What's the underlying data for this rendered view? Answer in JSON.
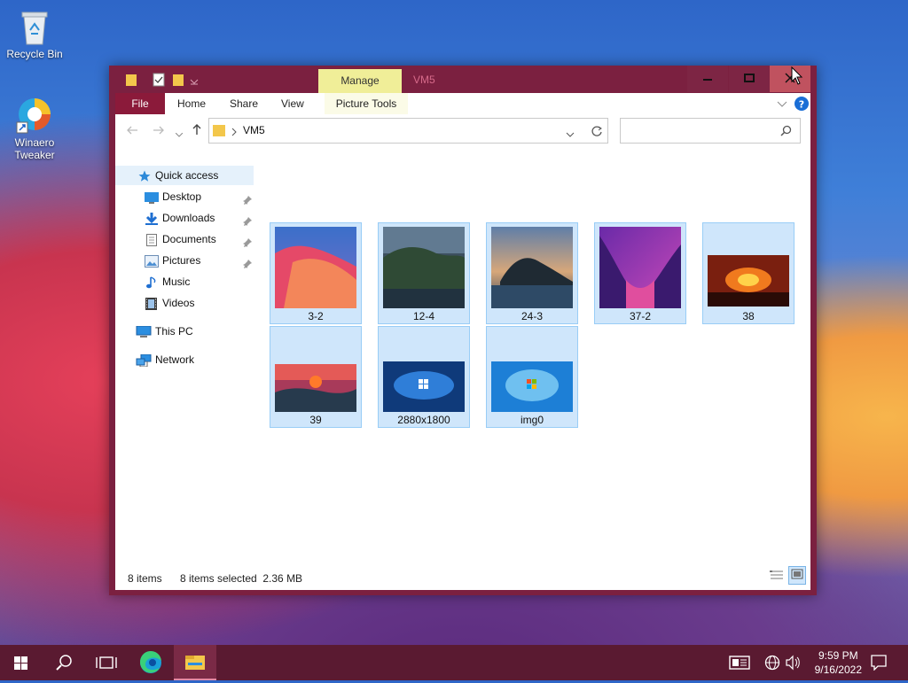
{
  "desktop": {
    "recycle_bin": "Recycle Bin",
    "winaero": "Winaero Tweaker"
  },
  "window": {
    "title": "VM5",
    "manage_tab": "Manage",
    "ribbon_tabs": [
      "File",
      "Home",
      "Share",
      "View",
      "Picture Tools"
    ],
    "address_path": "VM5",
    "search_placeholder": ""
  },
  "nav": {
    "items": [
      "Quick access",
      "Desktop",
      "Downloads",
      "Documents",
      "Pictures",
      "Music",
      "Videos",
      "This PC",
      "Network"
    ]
  },
  "files": [
    "3-2",
    "12-4",
    "24-3",
    "37-2",
    "38",
    "39",
    "2880x1800",
    "img0"
  ],
  "status": {
    "count": "8 items",
    "selection": "8 items selected  2.36 MB"
  },
  "taskbar": {
    "time": "9:59 PM",
    "date": "9/16/2022"
  },
  "colors": {
    "accent": "#7b2040",
    "file_tab": "#8b1a3a",
    "manage_tab": "#f0ee98",
    "selection": "#cfe6fb",
    "selection_border": "#99cdf6",
    "taskbar": "#5a1a31"
  }
}
